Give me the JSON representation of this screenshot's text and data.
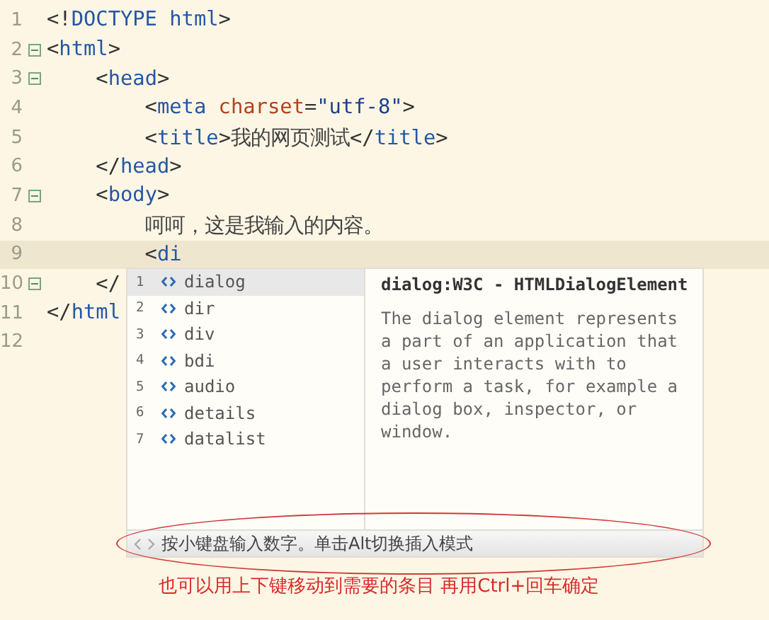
{
  "editor": {
    "lines": [
      {
        "number": "1",
        "fold": false,
        "current": false,
        "tokens": [
          {
            "kind": "bracket",
            "text": "<!"
          },
          {
            "kind": "tag",
            "text": "DOCTYPE html"
          },
          {
            "kind": "bracket",
            "text": ">"
          }
        ]
      },
      {
        "number": "2",
        "fold": true,
        "current": false,
        "tokens": [
          {
            "kind": "bracket",
            "text": "<"
          },
          {
            "kind": "tag",
            "text": "html"
          },
          {
            "kind": "bracket",
            "text": ">"
          }
        ]
      },
      {
        "number": "3",
        "fold": true,
        "current": false,
        "tokens": [
          {
            "kind": "bracket",
            "text": "    <"
          },
          {
            "kind": "tag",
            "text": "head"
          },
          {
            "kind": "bracket",
            "text": ">"
          }
        ]
      },
      {
        "number": "4",
        "fold": false,
        "current": false,
        "tokens": [
          {
            "kind": "bracket",
            "text": "        <"
          },
          {
            "kind": "tag",
            "text": "meta"
          },
          {
            "kind": "attr",
            "text": " charset"
          },
          {
            "kind": "bracket",
            "text": "="
          },
          {
            "kind": "string",
            "text": "\"utf-8\""
          },
          {
            "kind": "bracket",
            "text": ">"
          }
        ]
      },
      {
        "number": "5",
        "fold": false,
        "current": false,
        "tokens": [
          {
            "kind": "bracket",
            "text": "        <"
          },
          {
            "kind": "tag",
            "text": "title"
          },
          {
            "kind": "bracket",
            "text": ">"
          },
          {
            "kind": "text",
            "text": "我的网页测试"
          },
          {
            "kind": "bracket",
            "text": "</"
          },
          {
            "kind": "tag",
            "text": "title"
          },
          {
            "kind": "bracket",
            "text": ">"
          }
        ]
      },
      {
        "number": "6",
        "fold": false,
        "current": false,
        "tokens": [
          {
            "kind": "bracket",
            "text": "    </"
          },
          {
            "kind": "tag",
            "text": "head"
          },
          {
            "kind": "bracket",
            "text": ">"
          }
        ]
      },
      {
        "number": "7",
        "fold": true,
        "current": false,
        "tokens": [
          {
            "kind": "bracket",
            "text": "    <"
          },
          {
            "kind": "tag",
            "text": "body"
          },
          {
            "kind": "bracket",
            "text": ">"
          }
        ]
      },
      {
        "number": "8",
        "fold": false,
        "current": false,
        "tokens": [
          {
            "kind": "text",
            "text": "        呵呵，这是我输入的内容。"
          }
        ]
      },
      {
        "number": "9",
        "fold": false,
        "current": true,
        "tokens": [
          {
            "kind": "bracket",
            "text": "        <"
          },
          {
            "kind": "tag",
            "text": "di"
          }
        ]
      },
      {
        "number": "10",
        "fold": true,
        "current": false,
        "tokens": [
          {
            "kind": "bracket",
            "text": "    </"
          }
        ]
      },
      {
        "number": "11",
        "fold": false,
        "current": false,
        "tokens": [
          {
            "kind": "bracket",
            "text": "</"
          },
          {
            "kind": "tag",
            "text": "html"
          }
        ]
      },
      {
        "number": "12",
        "fold": false,
        "current": false
      }
    ]
  },
  "autocomplete": {
    "items": [
      {
        "index": "1",
        "label": "dialog",
        "selected": true
      },
      {
        "index": "2",
        "label": "dir",
        "selected": false
      },
      {
        "index": "3",
        "label": "div",
        "selected": false
      },
      {
        "index": "4",
        "label": "bdi",
        "selected": false
      },
      {
        "index": "5",
        "label": "audio",
        "selected": false
      },
      {
        "index": "6",
        "label": "details",
        "selected": false
      },
      {
        "index": "7",
        "label": "datalist",
        "selected": false
      }
    ],
    "detail": {
      "title": "dialog:W3C - HTMLDialogElement",
      "description": "The dialog element represents a part of an application that a user interacts with to perform a task, for example a dialog box, inspector, or window."
    },
    "hint": "按小键盘输入数字。单击Alt切换插入模式"
  },
  "annotation": {
    "text": "也可以用上下键移动到需要的条目 再用Ctrl+回车确定"
  }
}
